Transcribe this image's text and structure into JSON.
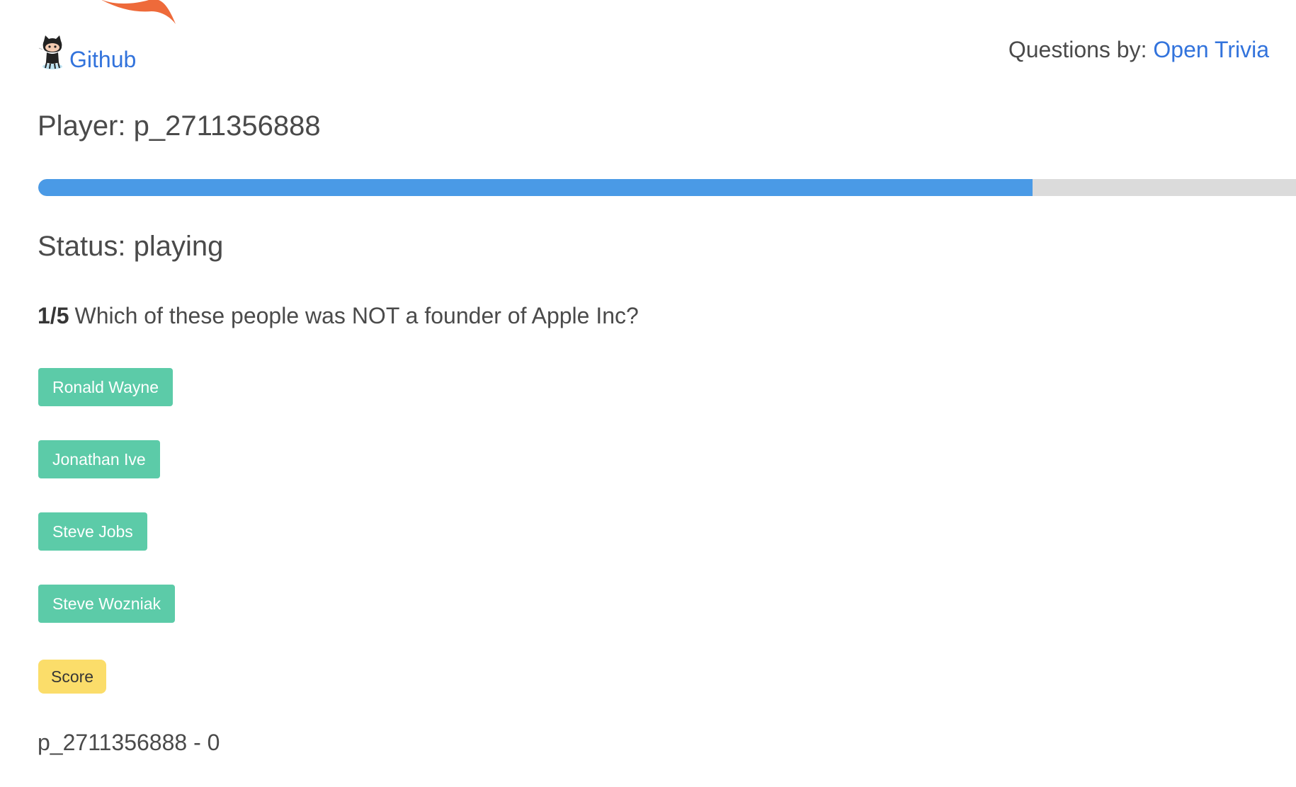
{
  "header": {
    "github_label": "Github",
    "credits_prefix": "Questions by:",
    "credits_link": "Open Trivia"
  },
  "player": {
    "title": "Player: p_2711356888"
  },
  "progress": {
    "fraction": 0.78
  },
  "status": {
    "title": "Status: playing"
  },
  "question": {
    "number": "1/5",
    "text": "Which of these people was NOT a founder of Apple Inc?"
  },
  "answers": [
    {
      "label": "Ronald Wayne"
    },
    {
      "label": "Jonathan Ive"
    },
    {
      "label": "Steve Jobs"
    },
    {
      "label": "Steve Wozniak"
    }
  ],
  "score": {
    "badge": "Score",
    "line": "p_2711356888 - 0"
  },
  "colors": {
    "link": "#3273dc",
    "progress_fill": "#4a9ae6",
    "progress_track": "#dbdbdb",
    "answer_button": "#5ccba8",
    "score_badge": "#fbdd6a",
    "logo_orange": "#ee6a3a"
  },
  "icons": {
    "logo": "orange-flame-logo-icon",
    "github": "octocat-icon"
  }
}
